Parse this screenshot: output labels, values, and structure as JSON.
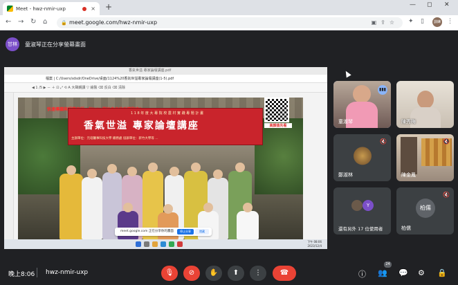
{
  "browser": {
    "tab_title": "Meet - hwz-nmir-uxp",
    "tab_close": "×",
    "new_tab": "+",
    "url": "meet.google.com/hwz-nmir-uxp",
    "profile_label": "訓練",
    "window_minimize": "—",
    "window_maximize": "◻",
    "window_close": "✕"
  },
  "banner": {
    "avatar_text": "甘林",
    "text": "童淑琴正在分享螢幕畫面"
  },
  "presentation": {
    "pdf_title": "香氣世溢 專家論壇講座.pdf",
    "pdf_address": "檔案 | C:/Users/sdsdr/OneDrive/桌面/1124%20香氣世溢專家論壇講座(1-5).pdf",
    "pdf_tools": "◀ 1  /5  ▶   －  ＋   ⊡   ⤢   ⟲    A 大聲朗讀    ▽ 繪製    ⌫ 反白    ⌫ 清除",
    "photo_headline": "快速導讀與評鑑老師一起DIY 屬於自己的香精配方！",
    "sign_subtitle": "1 1 8 年 度 大 專 院 校 農 村 實 踐 專 題 計 畫",
    "sign_title": "香氣世溢  專家論壇講座",
    "sign_organizer": "主辦單位：元培醫事科技大學 總務處   協辦單位：新竹大學等 ...",
    "qr_label": "高顏值先看",
    "meet_pill_text": "meet.google.com 正在分享你的畫面",
    "meet_pill_stop": "停止分享",
    "meet_pill_hide": "隱藏",
    "taskbar_clock_time": "下午 08:06",
    "taskbar_clock_date": "2023/12/4"
  },
  "participants": [
    {
      "name": "童淑琴",
      "muted": false,
      "speaking": true,
      "talk_icon": "▮▮▮"
    },
    {
      "name": "陳秀梅",
      "muted": false,
      "speaking": false
    },
    {
      "name": "鄭淑林",
      "muted": true,
      "speaking": false
    },
    {
      "name": "陳金鳳",
      "muted": true,
      "speaking": false
    },
    {
      "name": "還有另外 17 位使用者",
      "muted": false,
      "speaking": false,
      "avatar_letter": "Y"
    },
    {
      "name": "柏儒",
      "avatar_text": "柏儒",
      "muted": true,
      "speaking": false,
      "label": "柏儒"
    }
  ],
  "bottom": {
    "time": "晚上8:06",
    "meeting_code": "hwz-nmir-uxp",
    "people_count": "24",
    "mic_icon": "🎙",
    "cam_icon": "⊘",
    "hand_icon": "✋",
    "present_icon": "⬆",
    "more_icon": "⋮",
    "end_icon": "☎",
    "info_icon": "ⓘ",
    "people_icon": "👥",
    "chat_icon": "💬",
    "activities_icon": "⚙",
    "host_icon": "🔒"
  },
  "colors": {
    "accent": "#8ab4f8",
    "end_call": "#ea4335",
    "background": "#202124"
  }
}
